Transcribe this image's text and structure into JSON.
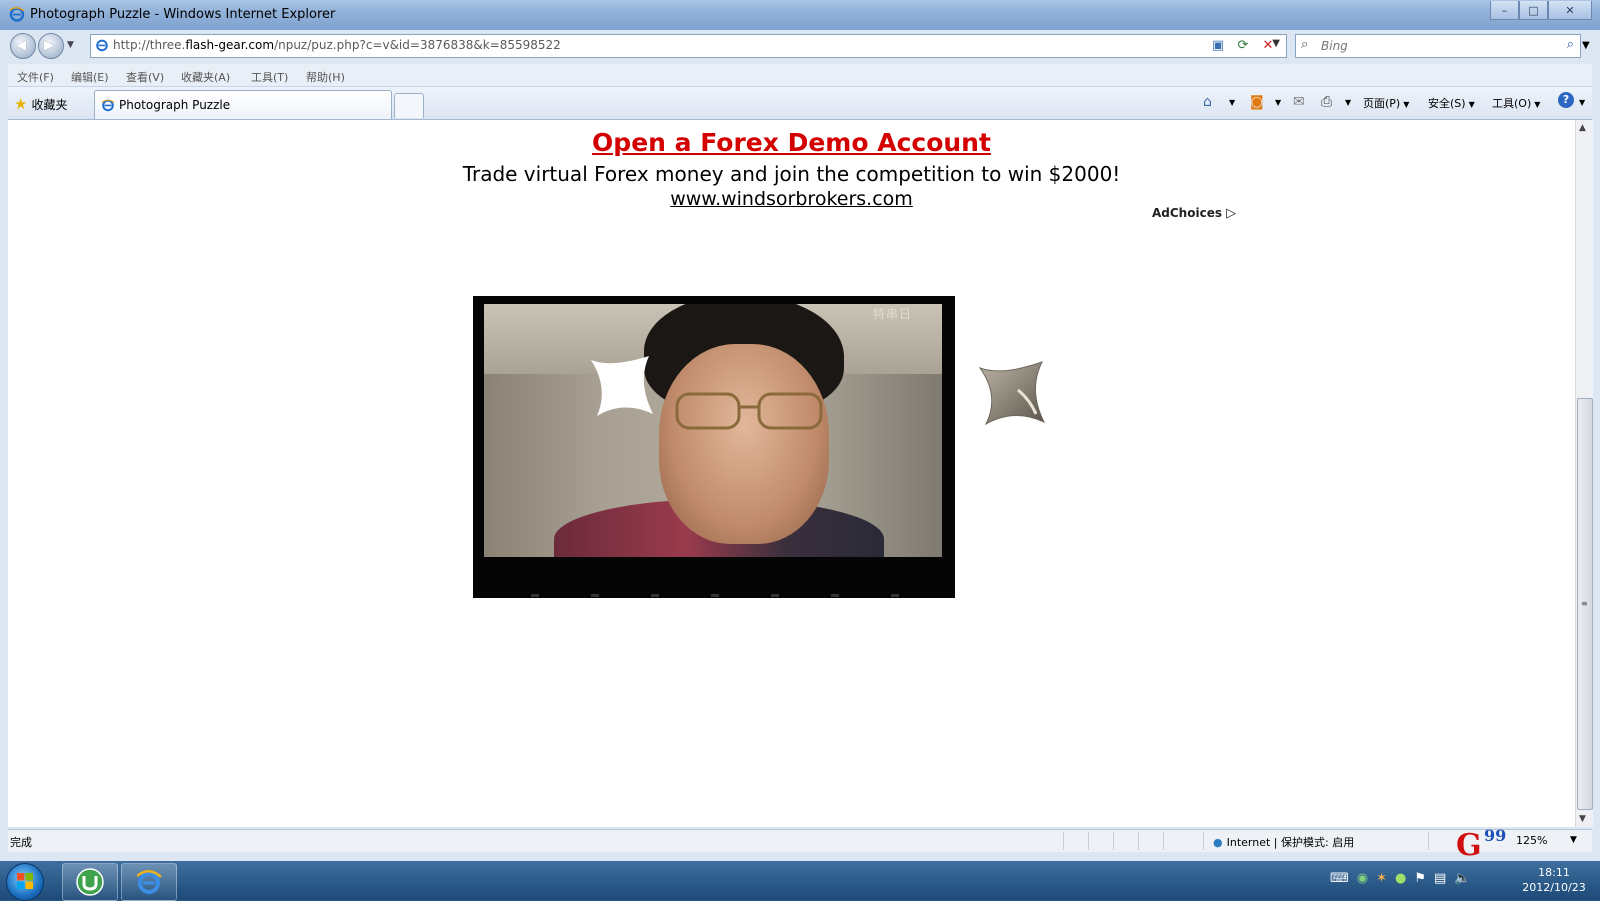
{
  "window": {
    "title": "Photograph Puzzle - Windows Internet Explorer",
    "buttons": {
      "minimize": "–",
      "maximize": "□",
      "close": "✕"
    }
  },
  "address_bar": {
    "url_prefix": "http://three.",
    "url_domain": "flash-gear.com",
    "url_path": "/npuz/puz.php?c=v&id=3876838&k=85598522"
  },
  "search": {
    "placeholder": "Bing"
  },
  "menu": {
    "items": [
      "文件(F)",
      "编辑(E)",
      "查看(V)",
      "收藏夹(A)",
      "工具(T)",
      "帮助(H)"
    ]
  },
  "tabs": {
    "favorites_label": "收藏夹",
    "active_tab": "Photograph Puzzle"
  },
  "command_bar": {
    "page": "页面(P)",
    "safety": "安全(S)",
    "tools": "工具(O)"
  },
  "ad": {
    "title": "Open a Forex Demo Account",
    "subtitle": "Trade virtual Forex money and join the competition to win $2000!",
    "url": "www.windsorbrokers.com",
    "adchoices": "AdChoices"
  },
  "puzzle": {
    "photo_watermark": "特串日"
  },
  "status": {
    "text": "完成",
    "zone": "Internet | 保护模式: 启用",
    "zoom": "125%"
  },
  "watermark_logo": {
    "g": "G",
    "nn": "99"
  },
  "taskbar": {
    "time": "18:11",
    "date": "2012/10/23"
  },
  "colors": {
    "ad_title": "#d40000",
    "titlebar": "#8fb0d8",
    "taskbar": "#1d4a78"
  }
}
